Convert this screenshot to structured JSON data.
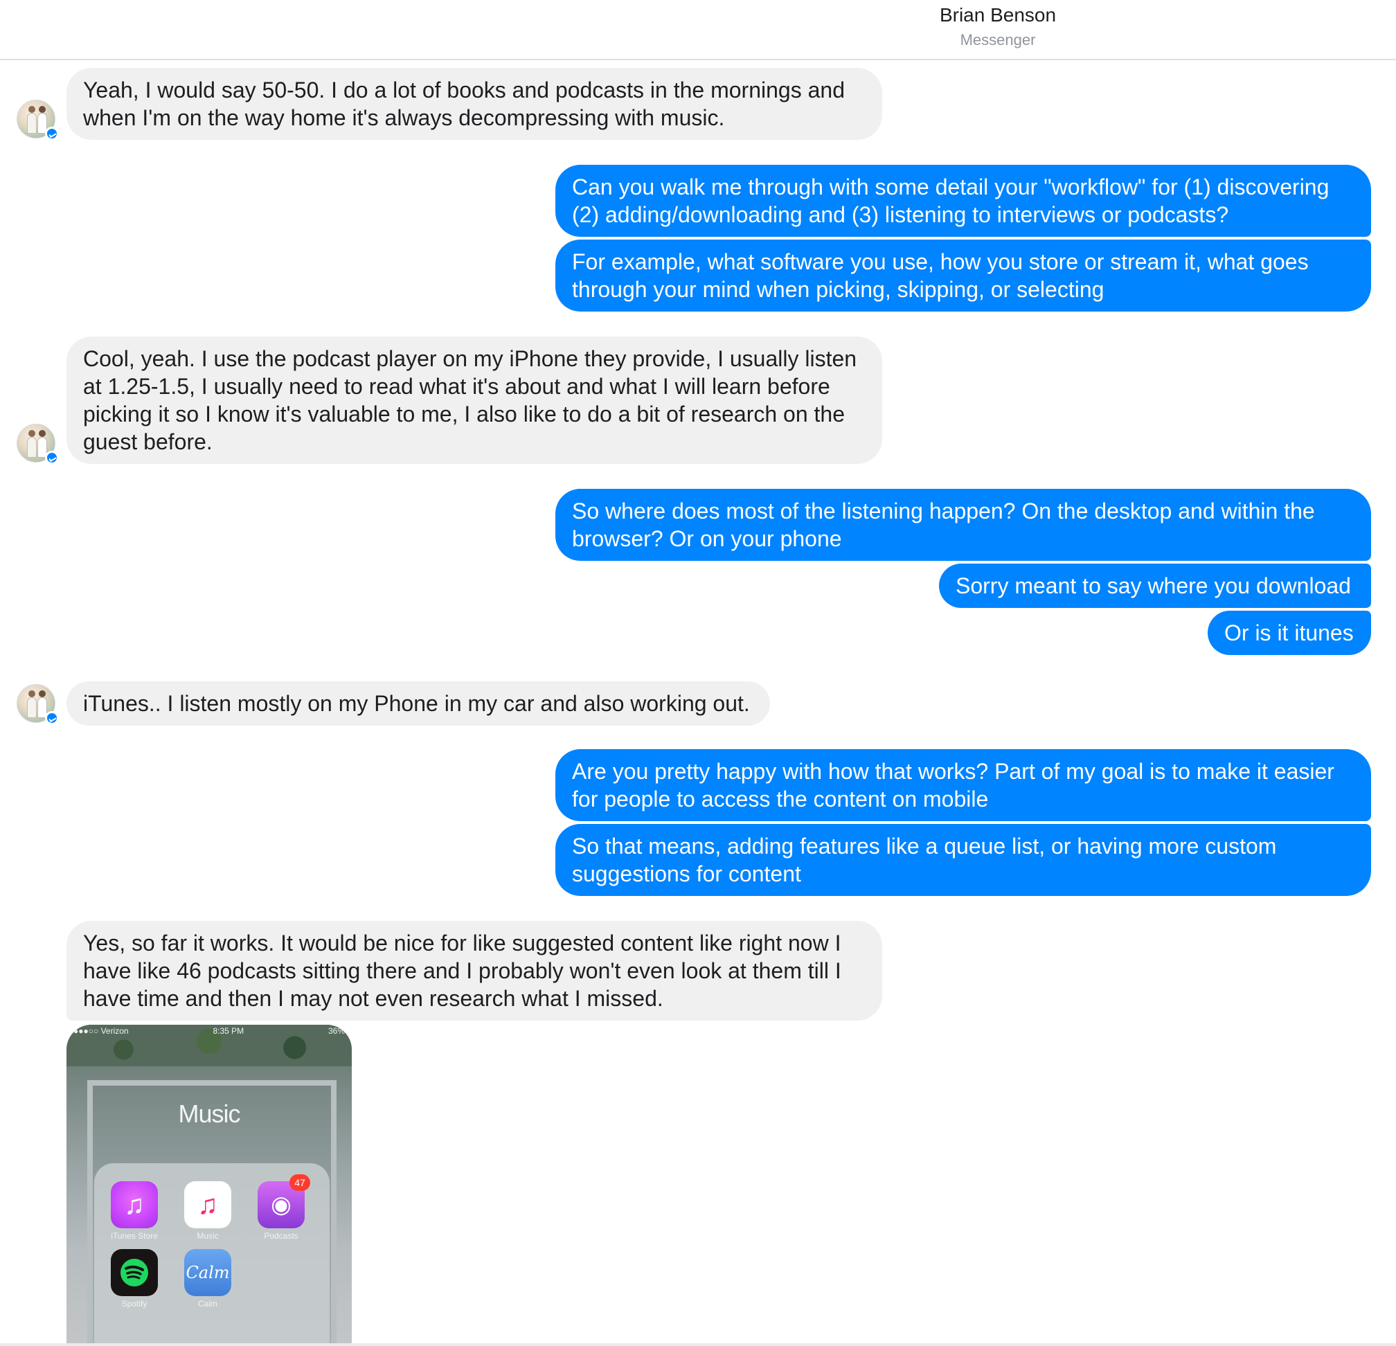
{
  "header": {
    "title": "Brian Benson",
    "subtitle": "Messenger"
  },
  "messages": [
    {
      "side": "in",
      "lines": [
        "Yeah, I would say 50-50. I do a lot of books and podcasts in the mornings and",
        "when I'm on the way home it's always decompressing with music."
      ]
    },
    {
      "side": "out",
      "lines": [
        "Can you walk me through with some detail your \"workflow\" for (1) discovering",
        "(2) adding/downloading and (3) listening to interviews or podcasts?"
      ]
    },
    {
      "side": "out",
      "lines": [
        "For example, what software you use, how you store or stream it, what goes",
        "through your mind when picking, skipping, or selecting"
      ]
    },
    {
      "side": "in",
      "lines": [
        "Cool, yeah. I use the podcast player on my iPhone they provide, I usually listen",
        "at 1.25-1.5, I usually need to read what it's about and what I will learn before",
        "picking it so I know it's valuable to me, I also like to do a bit of research on the",
        "guest before."
      ]
    },
    {
      "side": "out",
      "lines": [
        "So where does most of the listening happen? On the desktop and within the",
        "browser? Or on your phone"
      ]
    },
    {
      "side": "out",
      "lines": [
        "Sorry meant to say where you download"
      ]
    },
    {
      "side": "out",
      "lines": [
        "Or is it itunes"
      ]
    },
    {
      "side": "in",
      "lines": [
        "iTunes.. I listen mostly on my Phone in my car and also working out."
      ]
    },
    {
      "side": "out",
      "lines": [
        "Are you pretty happy with how that works? Part of my goal is to make it easier",
        "for people to access the content on mobile"
      ]
    },
    {
      "side": "out",
      "lines": [
        "So that means, adding features like a queue list, or having more custom",
        "suggestions for content"
      ]
    },
    {
      "side": "in",
      "lines": [
        "Yes, so far it works. It would be nice for like suggested content like right now I",
        "have like 46 podcasts sitting there and I probably won't even look at them till I",
        "have time and then I may not even research what I missed."
      ]
    }
  ],
  "attachment": {
    "status_left": "●●●○○ Verizon",
    "status_time": "8:35 PM",
    "status_right": "36%",
    "folder_title": "Music",
    "apps": [
      {
        "label": "iTunes Store",
        "icon": "itunes-store-icon",
        "color": "#c644fc"
      },
      {
        "label": "Music",
        "icon": "music-icon",
        "color": "#ffffff"
      },
      {
        "label": "Podcasts",
        "icon": "podcasts-icon",
        "color": "#a246e0",
        "badge": "47"
      },
      {
        "label": "Spotify",
        "icon": "spotify-icon",
        "color": "#191414"
      },
      {
        "label": "Calm",
        "icon": "calm-icon",
        "color": "#3f7fd9",
        "glyph": "Calm"
      }
    ]
  },
  "colors": {
    "outgoing": "#0084ff",
    "incoming": "#f1f0f0"
  }
}
